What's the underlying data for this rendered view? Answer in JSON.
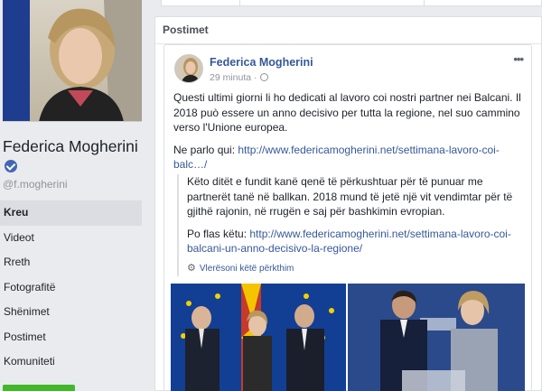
{
  "profile": {
    "name": "Federica Mogherini",
    "handle": "@f.mogherini"
  },
  "nav": {
    "items": [
      "Kreu",
      "Videot",
      "Rreth",
      "Fotografitë",
      "Shënimet",
      "Postimet",
      "Komuniteti"
    ],
    "active_index": 0
  },
  "section": {
    "title": "Postimet"
  },
  "post": {
    "author": "Federica Mogherini",
    "time": "29 minuta",
    "meta_separator": "·",
    "more_label": "•••",
    "text_p1": "Questi ultimi giorni li ho dedicati al lavoro coi nostri partner nei Balcani. Il 2018 può essere un anno decisivo per tutta la regione, nel suo cammino verso l'Unione europea.",
    "text_p2_prefix": "Ne parlo qui: ",
    "text_p2_link": "http://www.federicamogherini.net/settimana-lavoro-coi-balc…/",
    "translation_p1": "Këto ditët e fundit kanë qenë të përkushtuar për të punuar me partnerët tanë në ballkan. 2018 mund të jetë një vit vendimtar për të gjithë rajonin, në rrugën e saj për bashkimin evropian.",
    "translation_p2_prefix": "Po flas këtu: ",
    "translation_p2_link": "http://www.federicamogherini.net/settimana-lavoro-coi-balcani-un-anno-decisivo-la-regione/",
    "rate_translation": "Vlerësoni këtë përkthim"
  },
  "colors": {
    "link": "#365899",
    "eu_blue": "#0f3a8a",
    "active_nav_bg": "#dbdde2"
  },
  "icons": {
    "verified": "verified-badge-icon",
    "globe": "globe-icon",
    "gear": "gear-icon",
    "more": "more-options-icon"
  }
}
